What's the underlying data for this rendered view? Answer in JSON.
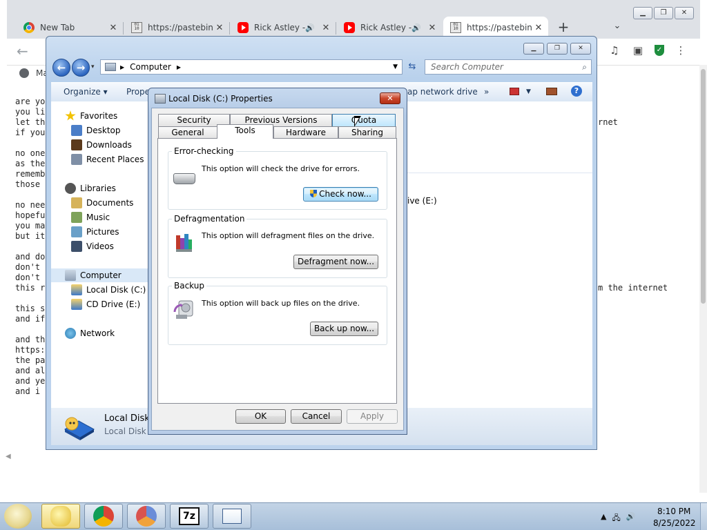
{
  "browser": {
    "tabs": [
      {
        "title": "New Tab",
        "icon": "chrome-icon",
        "audio": false,
        "active": false
      },
      {
        "title": "https://pastebin.",
        "icon": "pastebin-icon",
        "audio": false,
        "active": false
      },
      {
        "title": "Rick Astley -",
        "icon": "youtube-icon",
        "audio": true,
        "active": false
      },
      {
        "title": "Rick Astley -",
        "icon": "youtube-icon",
        "audio": true,
        "active": false
      },
      {
        "title": "https://pastebin.",
        "icon": "pastebin-icon",
        "audio": false,
        "active": true
      }
    ],
    "new_tab_glyph": "+",
    "bookmark_label": "Ma",
    "pastebin_lines": [
      "are yo",
      "you li",
      "let th",
      "if you",
      "",
      "no one",
      "as the",
      "rememb",
      "those",
      "",
      "no nee",
      "hopefu",
      "you ma",
      "but it",
      "",
      "and do",
      "don't",
      "don't",
      "this r",
      "",
      "this s",
      "and if",
      "",
      "and th",
      "https:",
      "the pa",
      "and al",
      "and ye",
      "and i"
    ],
    "right_text_1": "rnet",
    "right_text_2": "m the internet"
  },
  "explorer": {
    "breadcrumb": "Computer",
    "search_placeholder": "Search Computer",
    "toolbar": {
      "organize": "Organize ▾",
      "properties": "Prope",
      "map_drive": "ap network drive",
      "more": "»"
    },
    "nav": {
      "favorites": "Favorites",
      "desktop": "Desktop",
      "downloads": "Downloads",
      "recent_places": "Recent Places",
      "libraries": "Libraries",
      "documents": "Documents",
      "music": "Music",
      "pictures": "Pictures",
      "videos": "Videos",
      "computer": "Computer",
      "local_disk": "Local Disk (C:)",
      "cd_drive": "CD Drive (E:)",
      "network": "Network"
    },
    "content_drive": "ive (E:)",
    "details": {
      "name": "Local Disk",
      "type": "Local Disk"
    }
  },
  "dialog": {
    "title": "Local Disk (C:) Properties",
    "tabs_row1": [
      "Security",
      "Previous Versions",
      "Quota"
    ],
    "tabs_row2": [
      "General",
      "Tools",
      "Hardware",
      "Sharing"
    ],
    "selected_tab": "Tools",
    "error_checking": {
      "title": "Error-checking",
      "text": "This option will check the drive for errors.",
      "button": "Check now..."
    },
    "defragmentation": {
      "title": "Defragmentation",
      "text": "This option will defragment files on the drive.",
      "button": "Defragment now..."
    },
    "backup": {
      "title": "Backup",
      "text": "This option will back up files on the drive.",
      "button": "Back up now..."
    },
    "ok": "OK",
    "cancel": "Cancel",
    "apply": "Apply"
  },
  "taskbar": {
    "time": "8:10 PM",
    "date": "8/25/2022",
    "app_7zip_label": "7z"
  },
  "colors": {
    "accent_blue": "#3c7fb1",
    "close_red": "#c9462b",
    "explorer_frame": "#b9d1ec"
  }
}
